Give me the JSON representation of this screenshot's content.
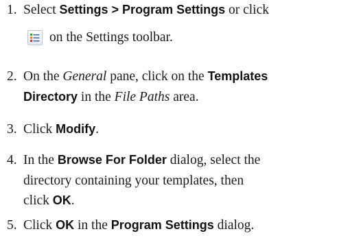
{
  "steps": [
    {
      "number": "1.",
      "line1": {
        "t1": "Select ",
        "b1": "Settings > Program Settings",
        "t2": " or click"
      },
      "line2": {
        "icon_name": "program-settings-icon",
        "t1": "on the Settings toolbar."
      }
    },
    {
      "number": "2.",
      "line1": {
        "t1": "On the ",
        "i1": "General",
        "t2": " pane, click on the ",
        "b1": "Templates"
      },
      "line2": {
        "b1": "Directory",
        "t1": " in the ",
        "i1": "File Paths",
        "t2": " area."
      }
    },
    {
      "number": "3.",
      "line1": {
        "t1": "Click ",
        "b1": "Modify",
        "t2": "."
      }
    },
    {
      "number": "4.",
      "line1": {
        "t1": "In the ",
        "b1": "Browse For Folder",
        "t2": " dialog, select the"
      },
      "line2": {
        "t1": "directory containing your templates, then"
      },
      "line3": {
        "t1": "click ",
        "b1": "OK",
        "t2": "."
      }
    },
    {
      "number": "5.",
      "line1": {
        "t1": "Click ",
        "b1": "OK",
        "t2": " in the ",
        "b2": "Program Settings",
        "t3": " dialog."
      }
    }
  ]
}
